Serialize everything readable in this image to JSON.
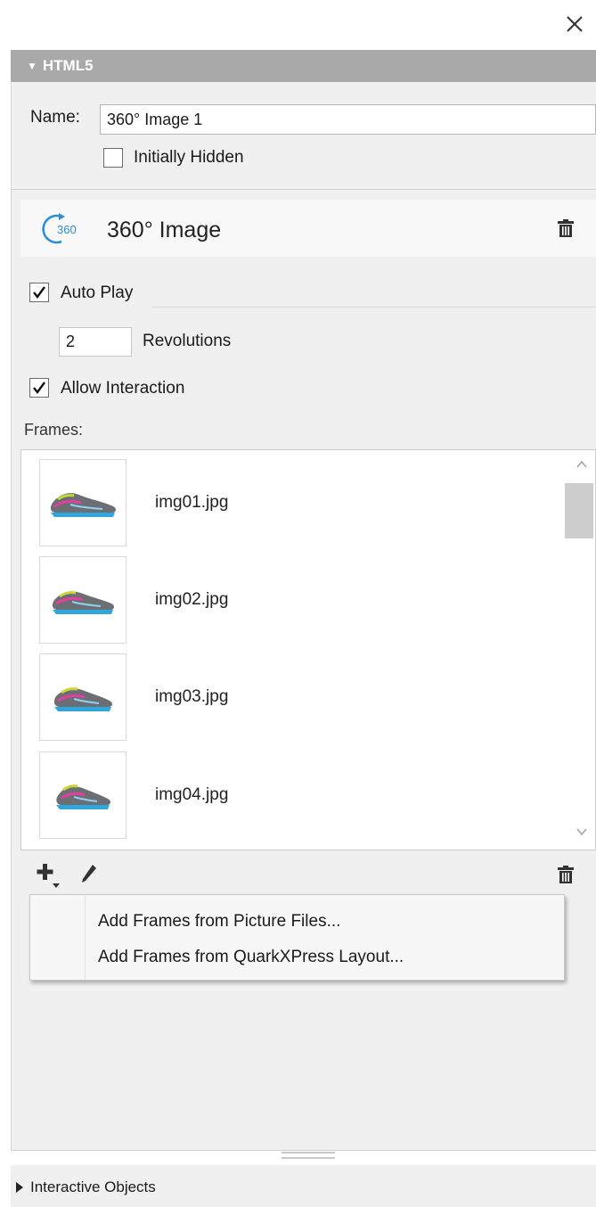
{
  "window": {
    "close_icon": "close-icon"
  },
  "section": {
    "title": "HTML5",
    "expand_icon": "triangle-down-icon"
  },
  "name_field": {
    "label": "Name:",
    "value": "360° Image 1"
  },
  "initially_hidden": {
    "label": "Initially Hidden",
    "checked": false
  },
  "object": {
    "title": "360° Image",
    "icon": "rotate-360-icon",
    "icon_text": "360",
    "accent_color": "#2b8fd6",
    "delete_icon": "trash-icon"
  },
  "auto_play": {
    "label": "Auto Play",
    "checked": true
  },
  "revolutions": {
    "value": "2",
    "label": "Revolutions"
  },
  "allow_interaction": {
    "label": "Allow Interaction",
    "checked": true
  },
  "frames": {
    "label": "Frames:",
    "items": [
      {
        "name": "img01.jpg",
        "thumbnail_icon": "shoe-image"
      },
      {
        "name": "img02.jpg",
        "thumbnail_icon": "shoe-image"
      },
      {
        "name": "img03.jpg",
        "thumbnail_icon": "shoe-image"
      },
      {
        "name": "img04.jpg",
        "thumbnail_icon": "shoe-image"
      }
    ]
  },
  "toolbar": {
    "add_icon": "plus-dropdown-icon",
    "edit_icon": "pencil-icon",
    "delete_icon": "trash-icon"
  },
  "add_menu": {
    "items": [
      "Add Frames from Picture Files...",
      "Add Frames from QuarkXPress Layout..."
    ]
  },
  "footer": {
    "label": "Interactive Objects",
    "expand_icon": "triangle-right-icon"
  }
}
